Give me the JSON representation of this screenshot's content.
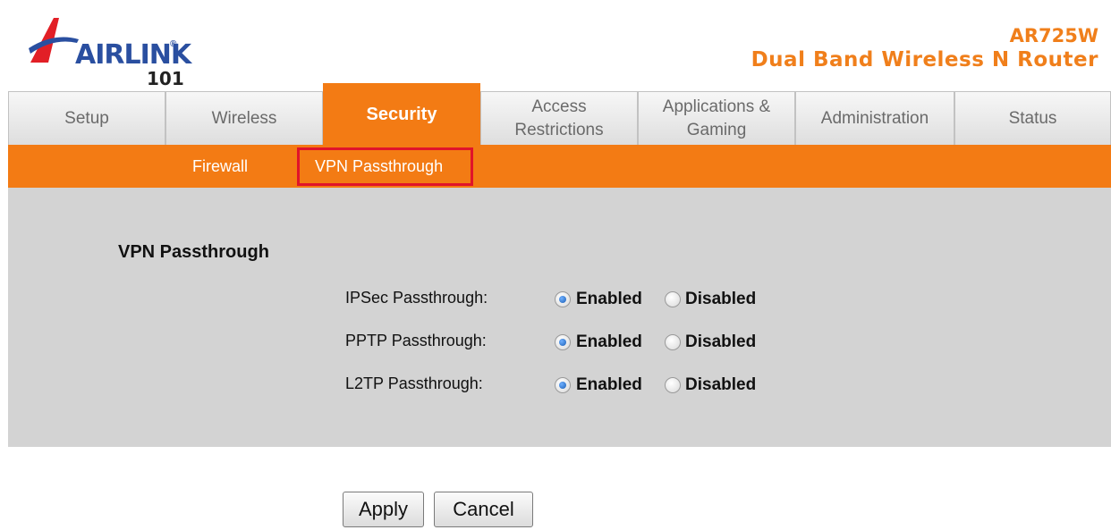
{
  "brand": {
    "logo_text": "AIRLINK",
    "logo_number": "101",
    "registered_mark": "®",
    "model": "AR725W",
    "product": "Dual Band Wireless N Router",
    "accent_color": "#f37b14"
  },
  "tabs": [
    {
      "label": "Setup",
      "active": false
    },
    {
      "label": "Wireless",
      "active": false
    },
    {
      "label": "Security",
      "active": true
    },
    {
      "label": "Access\nRestrictions",
      "active": false
    },
    {
      "label": "Applications &\nGaming",
      "active": false
    },
    {
      "label": "Administration",
      "active": false
    },
    {
      "label": "Status",
      "active": false
    }
  ],
  "subnav": {
    "items": [
      "Firewall",
      "VPN Passthrough"
    ],
    "selected": "VPN Passthrough"
  },
  "section": {
    "title": "VPN Passthrough",
    "rows": [
      {
        "label": "IPSec Passthrough:",
        "enabled_label": "Enabled",
        "disabled_label": "Disabled",
        "value": "Enabled"
      },
      {
        "label": "PPTP Passthrough:",
        "enabled_label": "Enabled",
        "disabled_label": "Disabled",
        "value": "Enabled"
      },
      {
        "label": "L2TP Passthrough:",
        "enabled_label": "Enabled",
        "disabled_label": "Disabled",
        "value": "Enabled"
      }
    ]
  },
  "buttons": {
    "apply": "Apply",
    "cancel": "Cancel"
  }
}
